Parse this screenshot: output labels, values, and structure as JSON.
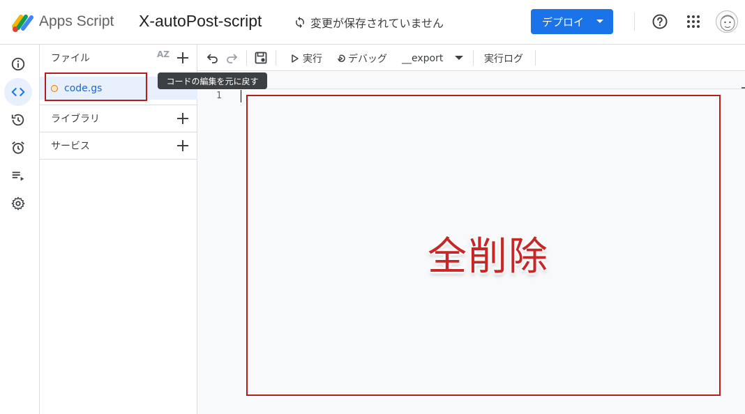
{
  "header": {
    "brand": "Apps Script",
    "project_title": "X-autoPost-script",
    "save_status": "変更が保存されていません",
    "deploy_label": "デプロイ"
  },
  "sidebar": {
    "files_label": "ファイル",
    "sort_label": "AZ",
    "file_name": "code.gs",
    "libraries_label": "ライブラリ",
    "services_label": "サービス"
  },
  "toolbar": {
    "run_label": "実行",
    "debug_label": "デバッグ",
    "function_select": "__export",
    "log_label": "実行ログ"
  },
  "tooltip": {
    "text": "コードの編集を元に戻す"
  },
  "editor": {
    "line_number": "1",
    "annotation": "全削除"
  },
  "colors": {
    "accent": "#1a73e8",
    "highlight": "#b71c1c",
    "annotation": "#c62828"
  }
}
